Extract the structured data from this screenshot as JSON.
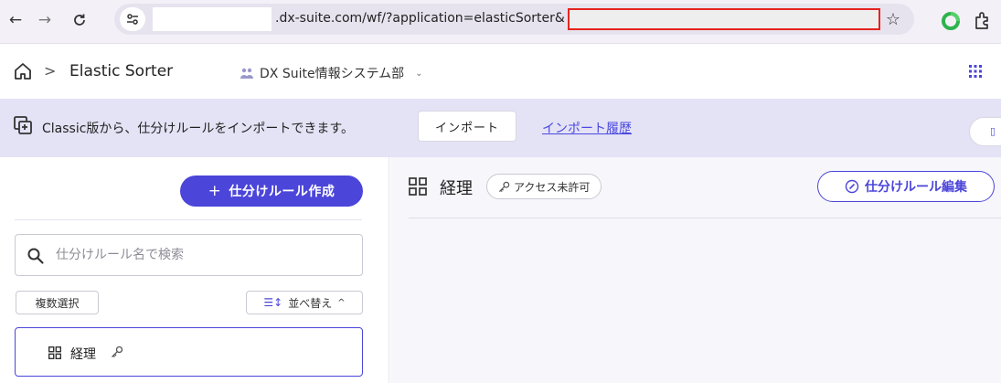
{
  "browser": {
    "url_visible": ".dx-suite.com/wf/?application=elasticSorter&",
    "icons": {
      "back": "arrow-left-icon",
      "forward": "arrow-right-icon",
      "reload": "reload-icon",
      "site_info": "tune-icon",
      "bookmark": "star-icon",
      "extension_1": "green-circle-extension-icon",
      "extensions": "puzzle-icon"
    },
    "redaction_border_color": "#e52420"
  },
  "header": {
    "app_title": "Elastic Sorter",
    "crumb_separator": ">",
    "org_name": "DX Suite情報システム部",
    "org_chevron": "⌄"
  },
  "banner": {
    "message": "Classic版から、仕分けルールをインポートできます。",
    "import_button": "インポート",
    "import_history_link": "インポート履歴"
  },
  "left_pane": {
    "create_button": "仕分けルール作成",
    "create_button_plus": "+",
    "search_placeholder": "仕分けルール名で検索",
    "multi_select_button": "複数選択",
    "sort_button": "並べ替え",
    "sort_chevron": "^",
    "rules": [
      {
        "name": "経理"
      }
    ]
  },
  "right_pane": {
    "rule_name": "経理",
    "access_badge": "アクセス未許可",
    "edit_button": "仕分けルール編集"
  },
  "colors": {
    "primary": "#4b45d9",
    "banner_bg": "#e4e2f5",
    "link": "#4a4ae0",
    "right_pane_bg": "#f6f6fb"
  }
}
